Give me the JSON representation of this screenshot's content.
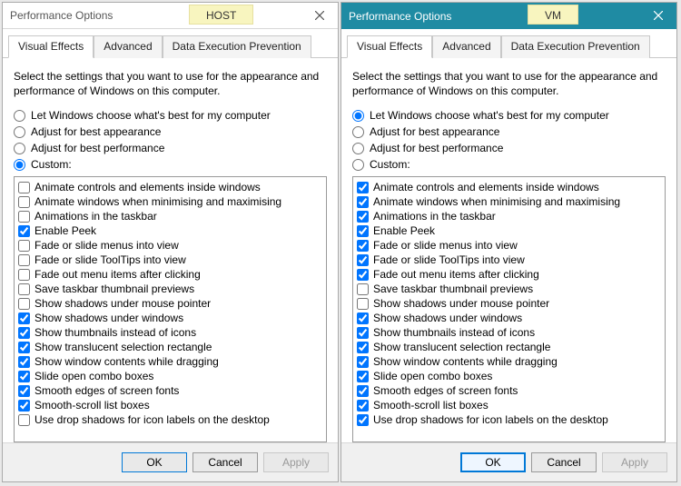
{
  "shared": {
    "title": "Performance Options",
    "intro": "Select the settings that you want to use for the appearance and performance of Windows on this computer.",
    "tabs": [
      "Visual Effects",
      "Advanced",
      "Data Execution Prevention"
    ],
    "radios": [
      "Let Windows choose what's best for my computer",
      "Adjust for best appearance",
      "Adjust for best performance",
      "Custom:"
    ],
    "options": [
      "Animate controls and elements inside windows",
      "Animate windows when minimising and maximising",
      "Animations in the taskbar",
      "Enable Peek",
      "Fade or slide menus into view",
      "Fade or slide ToolTips into view",
      "Fade out menu items after clicking",
      "Save taskbar thumbnail previews",
      "Show shadows under mouse pointer",
      "Show shadows under windows",
      "Show thumbnails instead of icons",
      "Show translucent selection rectangle",
      "Show window contents while dragging",
      "Slide open combo boxes",
      "Smooth edges of screen fonts",
      "Smooth-scroll list boxes",
      "Use drop shadows for icon labels on the desktop"
    ],
    "buttons": {
      "ok": "OK",
      "cancel": "Cancel",
      "apply": "Apply"
    }
  },
  "host": {
    "badge": "HOST",
    "active_tab": 0,
    "selected_radio": 3,
    "checked": [
      false,
      false,
      false,
      true,
      false,
      false,
      false,
      false,
      false,
      true,
      true,
      true,
      true,
      true,
      true,
      true,
      false
    ]
  },
  "vm": {
    "badge": "VM",
    "active_tab": 0,
    "selected_radio": 0,
    "checked": [
      true,
      true,
      true,
      true,
      true,
      true,
      true,
      false,
      false,
      true,
      true,
      true,
      true,
      true,
      true,
      true,
      true
    ]
  }
}
